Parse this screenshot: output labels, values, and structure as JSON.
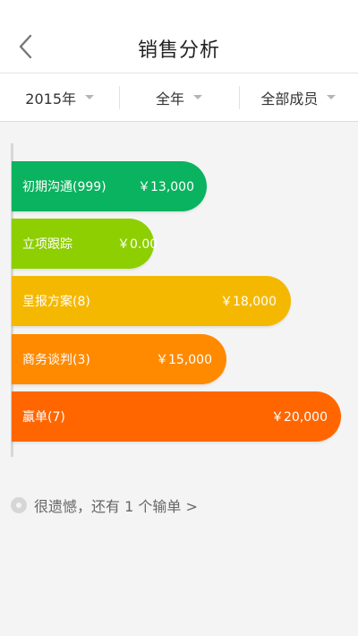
{
  "header": {
    "title": "销售分析",
    "back_icon": "chevron-left-icon"
  },
  "filters": {
    "year": "2015年",
    "period": "全年",
    "members": "全部成员"
  },
  "stages": [
    {
      "name": "初期沟通(999)",
      "amount": "￥13,000",
      "color": "#0ab35f",
      "value": 13000
    },
    {
      "name": "立项跟踪",
      "amount": "￥0.00",
      "color": "#8dcf00",
      "value": 0
    },
    {
      "name": "呈报方案(8)",
      "amount": "￥18,000",
      "color": "#f5b800",
      "value": 18000
    },
    {
      "name": "商务谈判(3)",
      "amount": "￥15,000",
      "color": "#ff8a00",
      "value": 15000
    },
    {
      "name": "赢单(7)",
      "amount": "￥20,000",
      "color": "#ff6600",
      "value": 20000
    }
  ],
  "lost_orders_text": "很遗憾，还有 1 个输单 >"
}
